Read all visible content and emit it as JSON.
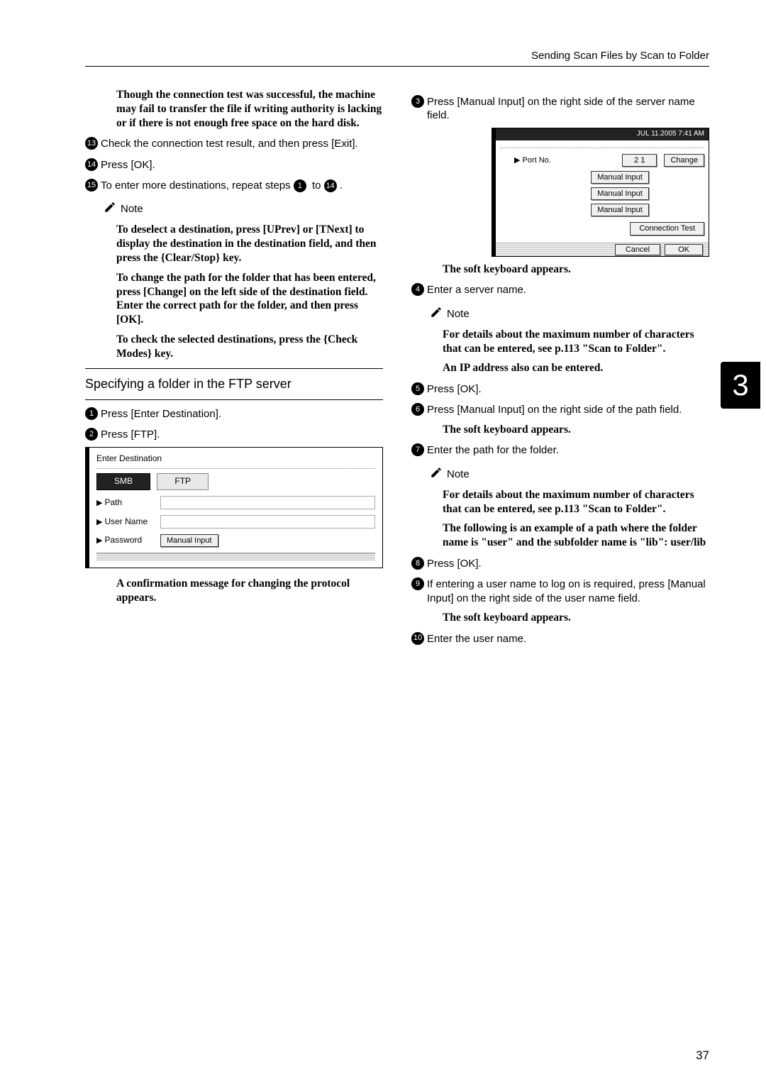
{
  "header": {
    "section_title": "Sending Scan Files by Scan to Folder"
  },
  "left": {
    "para1": "Though the connection test was successful, the machine may fail to transfer the file if writing authority is lacking or if there is not enough free space on the hard disk.",
    "step13": "Check the connection test result, and then press [Exit].",
    "step14": "Press [OK].",
    "step15_a": "To enter more destinations, repeat steps ",
    "step15_b": " to ",
    "step15_c": ".",
    "note_label": "Note",
    "note1": "To deselect a destination, press [UPrev] or [TNext] to display the destination in the destination field, and then press the {Clear/Stop} key.",
    "note2": "To change the path for the folder that has been entered, press [Change] on the left side of the destination field. Enter the correct path for the folder, and then press [OK].",
    "note3": "To check the selected destinations, press the {Check Modes} key.",
    "section_title": "Specifying a folder in the FTP server",
    "step1": "Press [Enter Destination].",
    "step2": "Press [FTP].",
    "panelA": {
      "title": "Enter Destination",
      "tab_dark": "SMB",
      "tab_light": "FTP",
      "path_label": "Path",
      "user_label": "User Name",
      "pass_label": "Password",
      "manual_btn": "Manual Input"
    },
    "confirm_text": "A confirmation message for changing the protocol appears."
  },
  "right": {
    "step3": "Press [Manual Input] on the right side of the server name field.",
    "panelB": {
      "topbar": "JUL   11.2005   7:41 AM",
      "port_label": "Port No.",
      "port_val": "2 1",
      "change_btn": "Change",
      "manual_btn": "Manual Input",
      "conn_test_btn": "Connection Test",
      "cancel_btn": "Cancel",
      "ok_btn": "OK"
    },
    "kb1": "The soft keyboard appears.",
    "step4": "Enter a server name.",
    "note_label": "Note",
    "note4": "For details about the maximum number of characters that can be entered, see p.113 \"Scan to Folder\".",
    "note4b": "An IP address also can be entered.",
    "step5": "Press [OK].",
    "step6": "Press [Manual Input] on the right side of the path field.",
    "kb2": "The soft keyboard appears.",
    "step7": "Enter the path for the folder.",
    "note7a": "For details about the maximum number of characters that can be entered, see p.113 \"Scan to Folder\".",
    "note7b": "The following is an example of a path where the folder name is \"user\" and the subfolder name is \"lib\": user/lib",
    "step8": "Press [OK].",
    "step9": "If entering a user name to log on is required, press [Manual Input] on the right side of the user name field.",
    "kb3": "The soft keyboard appears.",
    "step10": "Enter the user name."
  },
  "sidebar": "3",
  "page_number": "37"
}
